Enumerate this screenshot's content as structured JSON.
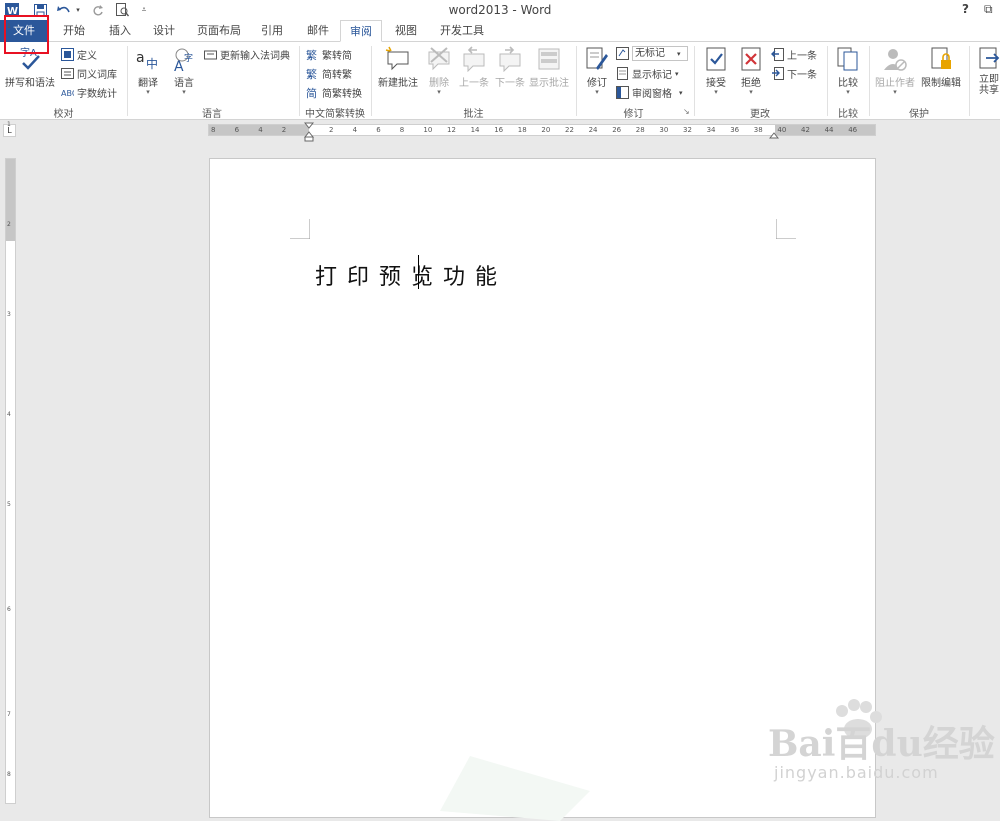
{
  "window": {
    "title": "word2013 - Word",
    "help": "?",
    "restore": "⧉"
  },
  "tabs": {
    "file": "文件",
    "home": "开始",
    "insert": "插入",
    "design": "设计",
    "layout": "页面布局",
    "references": "引用",
    "mailings": "邮件",
    "review": "审阅",
    "view": "视图",
    "developer": "开发工具"
  },
  "ribbon": {
    "proofing": {
      "label": "校对",
      "spelling": "拼写和语法",
      "define": "定义",
      "thesaurus": "同义词库",
      "wordcount": "字数统计"
    },
    "language": {
      "label": "语言",
      "translate": "翻译",
      "language": "语言",
      "update_ime": "更新输入法词典"
    },
    "chinese": {
      "label": "中文简繁转换",
      "t2s": "繁转简",
      "s2t": "简转繁",
      "convert": "简繁转换"
    },
    "comments": {
      "label": "批注",
      "new": "新建批注",
      "delete": "删除",
      "prev": "上一条",
      "next": "下一条",
      "show": "显示批注"
    },
    "tracking": {
      "label": "修订",
      "track": "修订",
      "markup_select": "无标记",
      "show_markup": "显示标记",
      "pane": "审阅窗格"
    },
    "changes": {
      "label": "更改",
      "accept": "接受",
      "reject": "拒绝",
      "prev": "上一条",
      "next": "下一条"
    },
    "compare": {
      "label": "比较",
      "compare": "比较"
    },
    "protect": {
      "label": "保护",
      "block": "阻止作者",
      "restrict": "限制编辑"
    },
    "share": {
      "label": "立即共享"
    }
  },
  "ruler": {
    "ticks": [
      "8",
      "6",
      "4",
      "2",
      "",
      "2",
      "4",
      "6",
      "8",
      "10",
      "12",
      "14",
      "16",
      "18",
      "20",
      "22",
      "24",
      "26",
      "28",
      "30",
      "32",
      "34",
      "36",
      "38",
      "40",
      "42",
      "44",
      "46"
    ],
    "vticks": [
      "1",
      "1",
      "2",
      "3",
      "4",
      "5",
      "6",
      "7",
      "8"
    ]
  },
  "document": {
    "text": "打印预览功能"
  },
  "watermark": {
    "brand": "Bai百du经验",
    "url": "jingyan.baidu.com"
  },
  "colors": {
    "accent": "#2b579a",
    "highlight_box": "#e81123"
  }
}
